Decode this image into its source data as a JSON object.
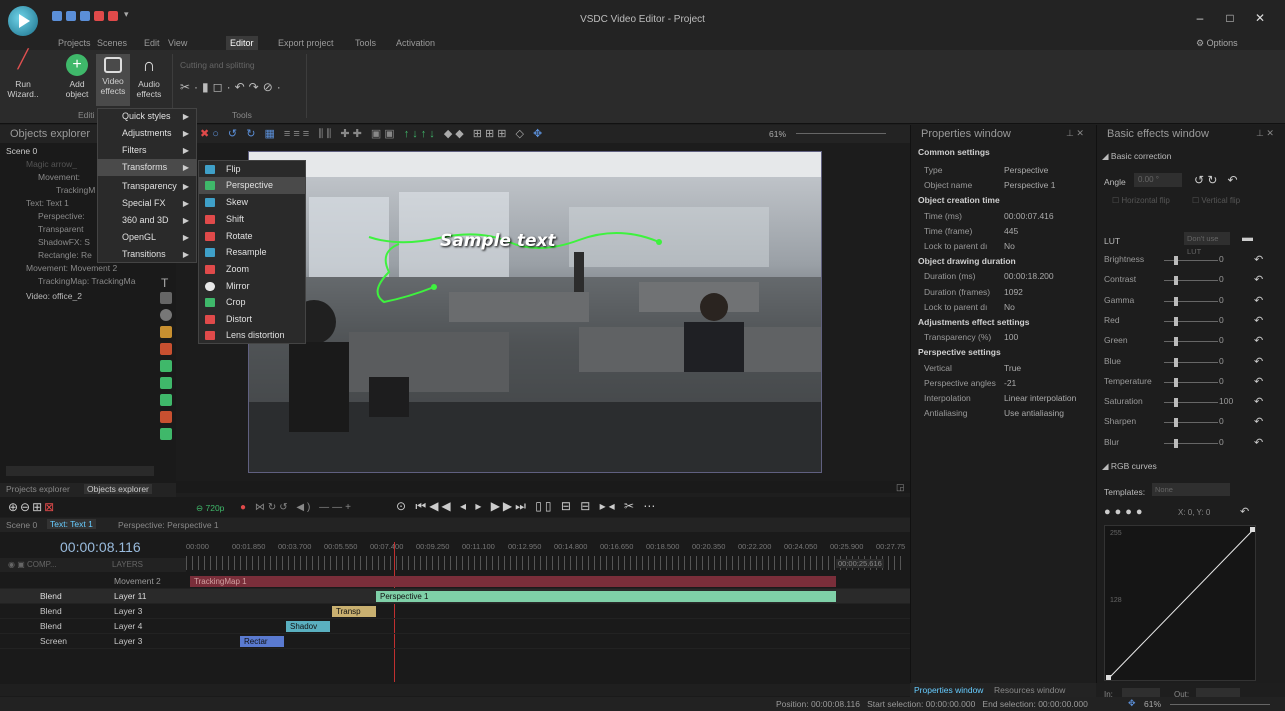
{
  "app": {
    "title": "VSDC Video Editor - Project",
    "options_label": "Options"
  },
  "menu": {
    "tabs": [
      "Projects",
      "Scenes",
      "Edit",
      "View",
      "Editor",
      "Export project",
      "Tools",
      "Activation"
    ],
    "active": "Editor"
  },
  "ribbon": {
    "buttons": [
      {
        "label": "Run Wizard..",
        "icon": "wand-icon"
      },
      {
        "label": "Add object",
        "icon": "add-icon"
      },
      {
        "label": "Video effects",
        "icon": "film-icon"
      },
      {
        "label": "Audio effects",
        "icon": "headphones-icon"
      }
    ],
    "group_editing": "Editi",
    "group_tools": "Tools",
    "cutting_label": "Cutting and splitting"
  },
  "effects_menu": {
    "items": [
      "Quick styles",
      "Adjustments",
      "Filters",
      "Transforms",
      "Transparency",
      "Special FX",
      "360 and 3D",
      "OpenGL",
      "Transitions"
    ],
    "highlighted": "Transforms"
  },
  "transforms_submenu": {
    "items": [
      {
        "label": "Flip",
        "color": "#3fa0c8"
      },
      {
        "label": "Perspective",
        "color": "#3fb86a"
      },
      {
        "label": "Skew",
        "color": "#3fa0c8"
      },
      {
        "label": "Shift",
        "color": "#e04a4a"
      },
      {
        "label": "Rotate",
        "color": "#e04a4a"
      },
      {
        "label": "Resample",
        "color": "#3fa0c8"
      },
      {
        "label": "Zoom",
        "color": "#e04a4a"
      },
      {
        "label": "Mirror",
        "color": "#e8e8e8"
      },
      {
        "label": "Crop",
        "color": "#3fb86a"
      },
      {
        "label": "Distort",
        "color": "#e04a4a"
      },
      {
        "label": "Lens distortion",
        "color": "#e04a4a"
      }
    ],
    "highlighted": "Perspective"
  },
  "objects_explorer": {
    "title": "Objects explorer",
    "tree": [
      "Scene 0",
      "Magic arrow_",
      "Movement: ",
      "TrackingM",
      "Text: Text 1",
      "Perspective: ",
      "Transparent",
      "ShadowFX: S",
      "Rectangle: Re",
      "Movement: Movement 2",
      "TrackingMap: TrackingMa",
      "Video: office_2"
    ],
    "tabs": [
      "Projects explorer",
      "Objects explorer"
    ]
  },
  "preview": {
    "sample_text": "Sample text",
    "zoom": "61%",
    "quality": "720p"
  },
  "properties": {
    "title": "Properties window",
    "rows": [
      {
        "k": "Common settings",
        "v": "",
        "section": true
      },
      {
        "k": "Type",
        "v": "Perspective"
      },
      {
        "k": "Object name",
        "v": "Perspective 1"
      },
      {
        "k": "Object creation time",
        "v": "",
        "section": true
      },
      {
        "k": "Time (ms)",
        "v": "00:00:07.416"
      },
      {
        "k": "Time (frame)",
        "v": "445"
      },
      {
        "k": "Lock to parent dı",
        "v": "No"
      },
      {
        "k": "Object drawing duration",
        "v": "",
        "section": true
      },
      {
        "k": "Duration (ms)",
        "v": "00:00:18.200"
      },
      {
        "k": "Duration (frames)",
        "v": "1092"
      },
      {
        "k": "Lock to parent dı",
        "v": "No"
      },
      {
        "k": "Adjustments effect settings",
        "v": "",
        "section": true
      },
      {
        "k": "Transparency (%)",
        "v": "100"
      },
      {
        "k": "Perspective settings",
        "v": "",
        "section": true
      },
      {
        "k": "Vertical",
        "v": "True"
      },
      {
        "k": "Perspective angles",
        "v": "-21"
      },
      {
        "k": "Interpolation",
        "v": "Linear interpolation"
      },
      {
        "k": "Antialiasing",
        "v": "Use antialiasing"
      }
    ],
    "tabs": [
      "Properties window",
      "Resources window"
    ]
  },
  "basic_effects": {
    "title": "Basic effects window",
    "section": "Basic correction",
    "angle_label": "Angle",
    "angle_value": "0.00 °",
    "flip_h": "Horizontal flip",
    "flip_v": "Vertical flip",
    "lut_label": "LUT",
    "lut_value": "Don't use LUT",
    "sliders": [
      {
        "label": "Brightness",
        "value": "0"
      },
      {
        "label": "Contrast",
        "value": "0"
      },
      {
        "label": "Gamma",
        "value": "0"
      },
      {
        "label": "Red",
        "value": "0"
      },
      {
        "label": "Green",
        "value": "0"
      },
      {
        "label": "Blue",
        "value": "0"
      },
      {
        "label": "Temperature",
        "value": "0"
      },
      {
        "label": "Saturation",
        "value": "100"
      },
      {
        "label": "Sharpen",
        "value": "0"
      },
      {
        "label": "Blur",
        "value": "0"
      }
    ],
    "curves_label": "RGB curves",
    "templates_label": "Templates:",
    "templates_value": "None",
    "xy": "X: 0, Y: 0",
    "curve_top": "255",
    "curve_mid": "128",
    "in_label": "In:",
    "out_label": "Out:"
  },
  "timeline": {
    "tabs": [
      "Scene 0",
      "Text: Text 1",
      "Perspective: Perspective 1"
    ],
    "timecode": "00:00:08.116",
    "end_time": "00:00:25.616",
    "header_comp": "COMP...",
    "header_layers": "LAYERS",
    "ruler": [
      "00:000",
      "00:01.850",
      "00:03.700",
      "00:05.550",
      "00:07.400",
      "00:09.250",
      "00:11.100",
      "00:12.950",
      "00:14.800",
      "00:16.650",
      "00:18.500",
      "00:20.350",
      "00:22.200",
      "00:24.050",
      "00:25.900",
      "00:27.75"
    ],
    "tracks": [
      {
        "blend": "",
        "layer": "Movement 2",
        "clip": "TrackingMap 1"
      },
      {
        "blend": "Blend",
        "layer": "Layer 11",
        "clip": "Perspective 1"
      },
      {
        "blend": "Blend",
        "layer": "Layer 3",
        "clip": "Transp"
      },
      {
        "blend": "Blend",
        "layer": "Layer 4",
        "clip": "Shadov"
      },
      {
        "blend": "Screen",
        "layer": "Layer 3",
        "clip": "Rectar"
      }
    ]
  },
  "status": {
    "position_label": "Position:",
    "position": "00:00:08.116",
    "start_label": "Start selection:",
    "start": "00:00:00.000",
    "end_label": "End selection:",
    "end": "00:00:00.000",
    "zoom": "61%"
  }
}
